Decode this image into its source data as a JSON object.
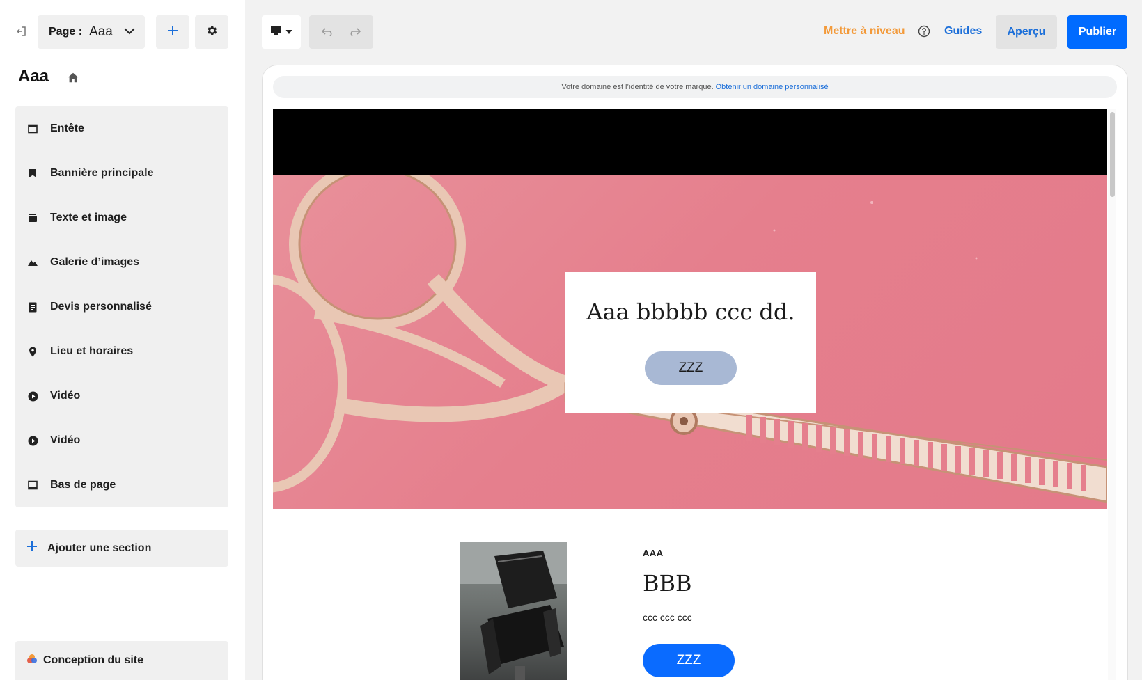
{
  "sidebar": {
    "page_select": {
      "label": "Page :",
      "value": "Aaa"
    },
    "site_title": "Aaa",
    "sections": [
      {
        "label": "Entête",
        "icon": "header-icon"
      },
      {
        "label": "Bannière principale",
        "icon": "bookmark-icon"
      },
      {
        "label": "Texte et image",
        "icon": "text-image-icon"
      },
      {
        "label": "Galerie d’images",
        "icon": "mountain-icon"
      },
      {
        "label": "Devis personnalisé",
        "icon": "quote-form-icon"
      },
      {
        "label": "Lieu et horaires",
        "icon": "location-pin-icon"
      },
      {
        "label": "Vidéo",
        "icon": "play-icon"
      },
      {
        "label": "Vidéo",
        "icon": "play-icon"
      },
      {
        "label": "Bas de page",
        "icon": "footer-icon"
      }
    ],
    "add_section_label": "Ajouter une section",
    "design_label": "Conception du site"
  },
  "toolbar": {
    "upgrade_label": "Mettre à niveau",
    "guides_label": "Guides",
    "preview_label": "Aperçu",
    "publish_label": "Publier"
  },
  "canvas": {
    "domain_notice": "Votre domaine est l’identité de votre marque.",
    "domain_link": "Obtenir un domaine personnalisé",
    "hero": {
      "title": "Aaa bbbbb ccc dd.",
      "button": "ZZZ"
    },
    "section2": {
      "eyebrow": "AAA",
      "title": "BBB",
      "body": "ccc ccc ccc",
      "button": "ZZZ"
    }
  },
  "colors": {
    "accent": "#006bff",
    "upgrade": "#f39a3a",
    "link": "#1c6fd9",
    "hero_bg": "#e57f8d",
    "hero_button": "#a8b8d4"
  }
}
